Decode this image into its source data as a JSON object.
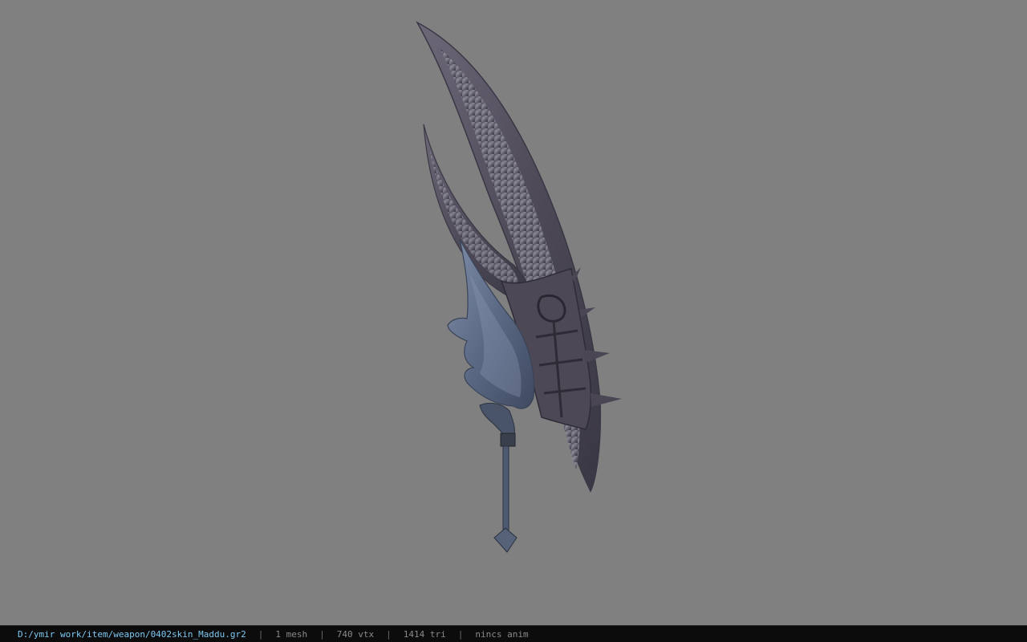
{
  "viewer": {
    "background_color": "#808080",
    "model": {
      "description_icon": "scythe-weapon-model"
    }
  },
  "status_bar": {
    "file_path": "D:/ymir work/item/weapon/0402skin_Maddu.gr2",
    "separator": "|",
    "mesh_count": "1 mesh",
    "vertex_count": "740 vtx",
    "triangle_count": "1414 tri",
    "anim_status": "nincs anim",
    "colors": {
      "background": "#0c0c0c",
      "path_text": "#7ec8f2",
      "info_text": "#8a8a8a"
    }
  }
}
